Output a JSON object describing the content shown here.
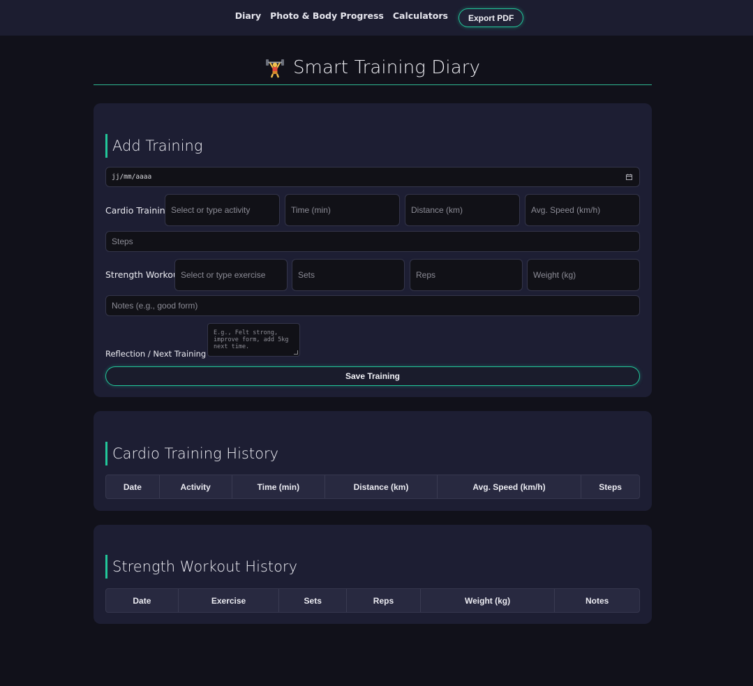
{
  "nav": {
    "links": [
      "Diary",
      "Photo & Body Progress",
      "Calculators"
    ],
    "export_label": "Export PDF"
  },
  "page": {
    "title": "Smart Training Diary",
    "icon": "weightlifter-icon"
  },
  "add_training": {
    "heading": "Add Training",
    "date_placeholder": "jj/mm/aaaa",
    "cardio_label": "Cardio Training",
    "cardio_fields": [
      "Select or type activity",
      "Time (min)",
      "Distance (km)",
      "Avg. Speed (km/h)"
    ],
    "steps_placeholder": "Steps",
    "strength_label": "Strength Workout",
    "strength_fields": [
      "Select or type exercise",
      "Sets",
      "Reps",
      "Weight (kg)"
    ],
    "notes_placeholder": "Notes (e.g., good form)",
    "reflection_label": "Reflection / Next Training Goal",
    "reflection_placeholder": "E.g., Felt strong, improve form, add 5kg next time.",
    "save_label": "Save Training"
  },
  "cardio_history": {
    "heading": "Cardio Training History",
    "columns": [
      "Date",
      "Activity",
      "Time (min)",
      "Distance (km)",
      "Avg. Speed (km/h)",
      "Steps"
    ]
  },
  "strength_history": {
    "heading": "Strength Workout History",
    "columns": [
      "Date",
      "Exercise",
      "Sets",
      "Reps",
      "Weight (kg)",
      "Notes"
    ]
  },
  "colors": {
    "accent": "#22c79a",
    "background": "#11111a",
    "card": "#1d1e33",
    "input": "#111117"
  }
}
